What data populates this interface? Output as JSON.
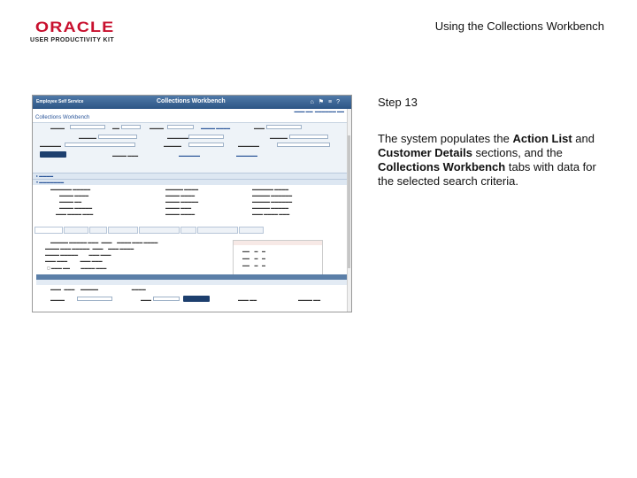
{
  "header": {
    "logo_text": "ORACLE",
    "logo_subtitle": "USER PRODUCTIVITY KIT",
    "title": "Using the Collections Workbench"
  },
  "step": {
    "label": "Step 13",
    "desc_1": "The system populates the ",
    "desc_b1": "Action List",
    "desc_2": " and ",
    "desc_b2": "Customer Details",
    "desc_3": " sections, and the ",
    "desc_b3": "Collections Workbench",
    "desc_4": " tabs with data for the selected search criteria."
  },
  "screenshot": {
    "back_label": "Employee Self Service",
    "window_title": "Collections Workbench",
    "page_heading": "Collections Workbench",
    "icon_names": [
      "home-icon",
      "worklist-icon",
      "menu-icon",
      "help-icon"
    ]
  },
  "colors": {
    "brand_red": "#c8102e",
    "header_blue": "#2d5585",
    "link_blue": "#2a5599",
    "button_navy": "#1d3f6e"
  }
}
